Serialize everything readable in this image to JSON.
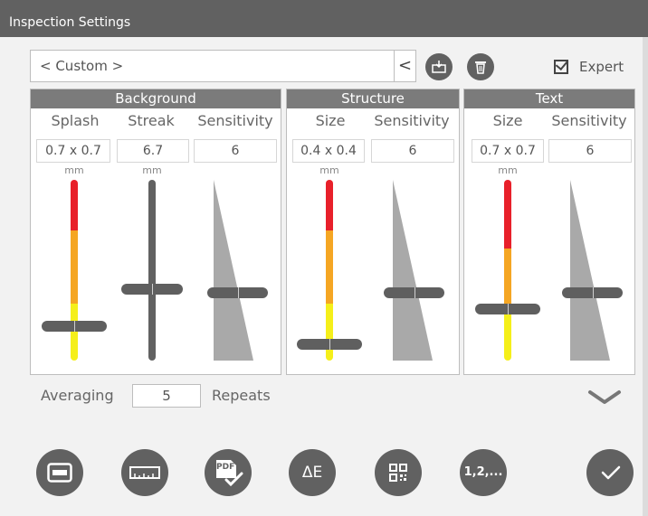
{
  "window": {
    "title": "Inspection Settings"
  },
  "preset": {
    "value": "< Custom >",
    "arrow": "<"
  },
  "toolbar": {
    "load_icon": "folder-load-icon",
    "delete_icon": "trash-icon"
  },
  "expert": {
    "label": "Expert",
    "checked": true
  },
  "panels": {
    "background": {
      "title": "Background",
      "columns": [
        {
          "label": "Splash",
          "value": "0.7 x 0.7",
          "unit": "mm",
          "level": 0.22
        },
        {
          "label": "Streak",
          "value": "6.7",
          "unit": "mm",
          "level": 0.4
        },
        {
          "label": "Sensitivity",
          "value": "6",
          "level": 0.38
        }
      ]
    },
    "structure": {
      "title": "Structure",
      "columns": [
        {
          "label": "Size",
          "value": "0.4 x 0.4",
          "unit": "mm",
          "level": 0.1
        },
        {
          "label": "Sensitivity",
          "value": "6",
          "level": 0.38
        }
      ]
    },
    "text": {
      "title": "Text",
      "columns": [
        {
          "label": "Size",
          "value": "0.7 x 0.7",
          "unit": "mm",
          "level": 0.29
        },
        {
          "label": "Sensitivity",
          "value": "6",
          "level": 0.38
        }
      ]
    }
  },
  "averaging": {
    "label": "Averaging",
    "value": "5",
    "repeats_label": "Repeats"
  },
  "bottom_toolbar": [
    {
      "name": "region-button",
      "icon": "rectangle-region-icon"
    },
    {
      "name": "ruler-button",
      "icon": "ruler-icon"
    },
    {
      "name": "pdf-check-button",
      "icon": "pdf-check-icon",
      "label": "PDF"
    },
    {
      "name": "delta-e-button",
      "icon": "delta-e-icon",
      "label": "ΔE"
    },
    {
      "name": "qr-code-button",
      "icon": "qr-code-icon"
    },
    {
      "name": "numbering-button",
      "icon": "numbering-icon",
      "label": "1,2,..."
    },
    {
      "name": "confirm-button",
      "icon": "checkmark-icon"
    }
  ],
  "colors": {
    "title_bar": "#616161",
    "panel_header": "#7b7b7b",
    "red": "#e8202a",
    "orange": "#f5a623",
    "yellow": "#f5ef1a",
    "dark_gray": "#616161",
    "wedge": "#a9a9a9"
  }
}
